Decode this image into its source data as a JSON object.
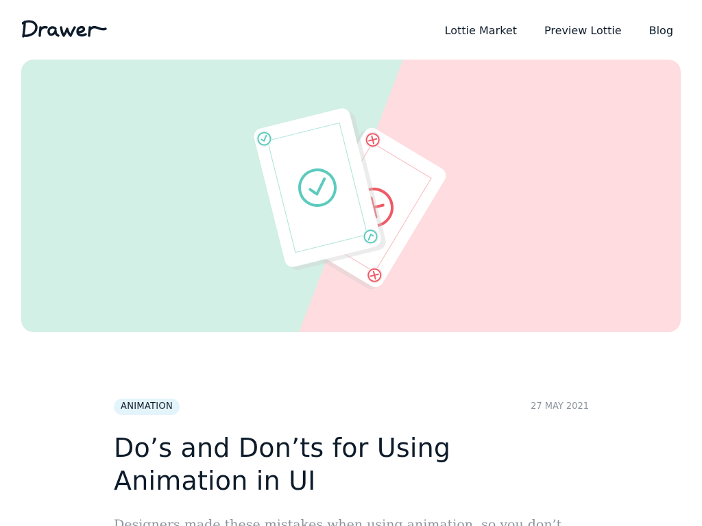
{
  "brand": {
    "logo_text": "Drawer"
  },
  "nav": {
    "items": [
      {
        "label": "Lottie Market"
      },
      {
        "label": "Preview Lottie"
      },
      {
        "label": "Blog"
      }
    ]
  },
  "hero": {
    "colors": {
      "left": "#d2f0e5",
      "right": "#ffdcdf",
      "accent_good": "#5ccbbe",
      "accent_bad": "#ee5a66"
    }
  },
  "article": {
    "category": "ANIMATION",
    "date": "27 MAY 2021",
    "title": "Do’s and Don’ts for Using Animation in UI",
    "lede": "Designers made these mistakes when using animation, so you don’t"
  }
}
